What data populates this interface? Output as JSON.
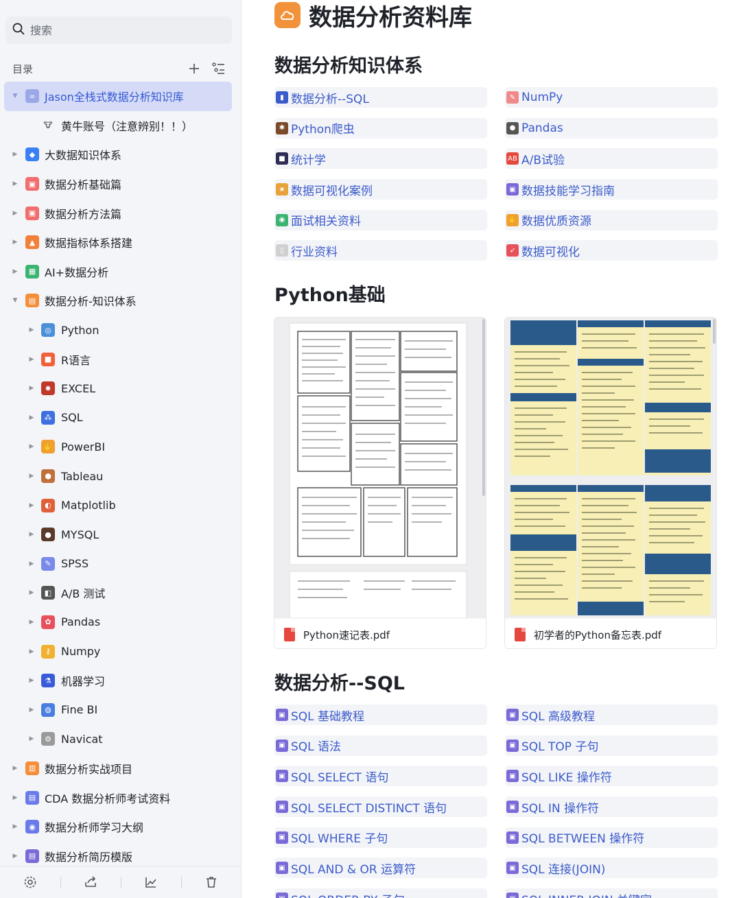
{
  "search": {
    "placeholder": "搜索"
  },
  "toc": {
    "title": "目录",
    "items": [
      {
        "label": "Jason全栈式数据分析知识库",
        "level": 0,
        "expanded": true,
        "selected": true,
        "icon": "link-icon",
        "color": "#9aa8e8",
        "glyph": "∞"
      },
      {
        "label": "黄牛账号（注意辨别！！）",
        "level": 1,
        "expanded": null,
        "selected": false,
        "icon": "cow-icon",
        "color": "#ffffff",
        "glyph": "🐮"
      },
      {
        "label": "大数据知识体系",
        "level": 0,
        "expanded": false,
        "selected": false,
        "icon": "cube-icon",
        "color": "#3a7ff5",
        "glyph": "◆"
      },
      {
        "label": "数据分析基础篇",
        "level": 0,
        "expanded": false,
        "selected": false,
        "icon": "book-icon",
        "color": "#f26d6d",
        "glyph": "▣"
      },
      {
        "label": "数据分析方法篇",
        "level": 0,
        "expanded": false,
        "selected": false,
        "icon": "book-icon",
        "color": "#f26d6d",
        "glyph": "▣"
      },
      {
        "label": "数据指标体系搭建",
        "level": 0,
        "expanded": false,
        "selected": false,
        "icon": "chart-icon",
        "color": "#f0803a",
        "glyph": "▲"
      },
      {
        "label": "AI+数据分析",
        "level": 0,
        "expanded": false,
        "selected": false,
        "icon": "grid-icon",
        "color": "#3cb371",
        "glyph": "▦"
      },
      {
        "label": "数据分析-知识体系",
        "level": 0,
        "expanded": true,
        "selected": false,
        "icon": "folder-icon",
        "color": "#f58e3a",
        "glyph": "▤"
      },
      {
        "label": "Python",
        "level": 1,
        "expanded": false,
        "selected": false,
        "icon": "python-icon",
        "color": "#4a90d9",
        "glyph": "◎"
      },
      {
        "label": "R语言",
        "level": 1,
        "expanded": false,
        "selected": false,
        "icon": "r-icon",
        "color": "#f2623a",
        "glyph": "■"
      },
      {
        "label": "EXCEL",
        "level": 1,
        "expanded": false,
        "selected": false,
        "icon": "bug-icon",
        "color": "#c0392b",
        "glyph": "✸"
      },
      {
        "label": "SQL",
        "level": 1,
        "expanded": false,
        "selected": false,
        "icon": "database-icon",
        "color": "#3d6fe0",
        "glyph": "⁂"
      },
      {
        "label": "PowerBI",
        "level": 1,
        "expanded": false,
        "selected": false,
        "icon": "hand-icon",
        "color": "#f0a030",
        "glyph": "✋"
      },
      {
        "label": "Tableau",
        "level": 1,
        "expanded": false,
        "selected": false,
        "icon": "box-icon",
        "color": "#c0703a",
        "glyph": "⬢"
      },
      {
        "label": "Matplotlib",
        "level": 1,
        "expanded": false,
        "selected": false,
        "icon": "palette-icon",
        "color": "#e0603a",
        "glyph": "◐"
      },
      {
        "label": "MYSQL",
        "level": 1,
        "expanded": false,
        "selected": false,
        "icon": "dolphin-icon",
        "color": "#5b3a2a",
        "glyph": "●"
      },
      {
        "label": "SPSS",
        "level": 1,
        "expanded": false,
        "selected": false,
        "icon": "pen-icon",
        "color": "#7a8ae8",
        "glyph": "✎"
      },
      {
        "label": "A/B 测试",
        "level": 1,
        "expanded": false,
        "selected": false,
        "icon": "cup-icon",
        "color": "#555555",
        "glyph": "◧"
      },
      {
        "label": "Pandas",
        "level": 1,
        "expanded": false,
        "selected": false,
        "icon": "flower-icon",
        "color": "#e8505b",
        "glyph": "✿"
      },
      {
        "label": "Numpy",
        "level": 1,
        "expanded": false,
        "selected": false,
        "icon": "key-icon",
        "color": "#f0b030",
        "glyph": "⚷"
      },
      {
        "label": "机器学习",
        "level": 1,
        "expanded": false,
        "selected": false,
        "icon": "microscope-icon",
        "color": "#3a5bd9",
        "glyph": "⚗"
      },
      {
        "label": "Fine BI",
        "level": 1,
        "expanded": false,
        "selected": false,
        "icon": "globe-icon",
        "color": "#4a7fe0",
        "glyph": "◍"
      },
      {
        "label": "Navicat",
        "level": 1,
        "expanded": false,
        "selected": false,
        "icon": "gear-icon",
        "color": "#9a9a9a",
        "glyph": "⚙"
      },
      {
        "label": "数据分析实战项目",
        "level": 0,
        "expanded": false,
        "selected": false,
        "icon": "briefcase-icon",
        "color": "#f58e3a",
        "glyph": "▥"
      },
      {
        "label": "CDA 数据分析师考试资料",
        "level": 0,
        "expanded": false,
        "selected": false,
        "icon": "doc-icon",
        "color": "#6a7ae8",
        "glyph": "▤"
      },
      {
        "label": "数据分析师学习大纲",
        "level": 0,
        "expanded": false,
        "selected": false,
        "icon": "target-icon",
        "color": "#6a7ae8",
        "glyph": "◉"
      },
      {
        "label": "数据分析简历模版",
        "level": 0,
        "expanded": false,
        "selected": false,
        "icon": "doc-icon",
        "color": "#7a6ad8",
        "glyph": "▤"
      }
    ]
  },
  "doc": {
    "title": "数据分析资料库"
  },
  "sections": [
    {
      "heading": "数据分析知识体系",
      "links": [
        {
          "label": "数据分析--SQL",
          "icon": "bar-chart-icon",
          "color": "#3b5bcb",
          "glyph": "▮"
        },
        {
          "label": "NumPy",
          "icon": "pencil-icon",
          "color": "#f08a8a",
          "glyph": "✎"
        },
        {
          "label": "Python爬虫",
          "icon": "spider-icon",
          "color": "#7a4a2a",
          "glyph": "✱"
        },
        {
          "label": "Pandas",
          "icon": "panda-icon",
          "color": "#555555",
          "glyph": "●"
        },
        {
          "label": "统计学",
          "icon": "save-icon",
          "color": "#2c2c54",
          "glyph": "■"
        },
        {
          "label": "A/B试验",
          "icon": "ab-icon",
          "color": "#e5483f",
          "glyph": "AB"
        },
        {
          "label": "数据可视化案例",
          "icon": "medal-icon",
          "color": "#e8a23a",
          "glyph": "★"
        },
        {
          "label": "数据技能学习指南",
          "icon": "book-icon",
          "color": "#7a6ad8",
          "glyph": "▣"
        },
        {
          "label": "面试相关资料",
          "icon": "chat-icon",
          "color": "#3cb371",
          "glyph": "◉"
        },
        {
          "label": "数据优质资源",
          "icon": "hand-icon",
          "color": "#f0a030",
          "glyph": "✋"
        },
        {
          "label": "行业资料",
          "icon": "bookmark-icon",
          "color": "#d0d0d0",
          "glyph": "▯"
        },
        {
          "label": "数据可视化",
          "icon": "rocket-icon",
          "color": "#e8505b",
          "glyph": "➶"
        }
      ]
    },
    {
      "heading": "Python基础",
      "files": [
        {
          "name": "Python速记表.pdf",
          "icon": "pdf-icon"
        },
        {
          "name": "初学者的Python备忘表.pdf",
          "icon": "pdf-icon"
        }
      ]
    },
    {
      "heading": "数据分析--SQL",
      "links": [
        {
          "label": "SQL 基础教程",
          "icon": "book-icon",
          "color": "#7a6ad8",
          "glyph": "▣"
        },
        {
          "label": "SQL 高级教程",
          "icon": "book-icon",
          "color": "#7a6ad8",
          "glyph": "▣"
        },
        {
          "label": "SQL 语法",
          "icon": "book-icon",
          "color": "#7a6ad8",
          "glyph": "▣"
        },
        {
          "label": "SQL TOP 子句",
          "icon": "book-icon",
          "color": "#7a6ad8",
          "glyph": "▣"
        },
        {
          "label": "SQL SELECT 语句",
          "icon": "book-icon",
          "color": "#7a6ad8",
          "glyph": "▣"
        },
        {
          "label": "SQL LIKE 操作符",
          "icon": "book-icon",
          "color": "#7a6ad8",
          "glyph": "▣"
        },
        {
          "label": "SQL SELECT DISTINCT 语句",
          "icon": "book-icon",
          "color": "#7a6ad8",
          "glyph": "▣"
        },
        {
          "label": "SQL IN 操作符",
          "icon": "book-icon",
          "color": "#7a6ad8",
          "glyph": "▣"
        },
        {
          "label": "SQL WHERE 子句",
          "icon": "book-icon",
          "color": "#7a6ad8",
          "glyph": "▣"
        },
        {
          "label": "SQL BETWEEN 操作符",
          "icon": "book-icon",
          "color": "#7a6ad8",
          "glyph": "▣"
        },
        {
          "label": "SQL AND & OR 运算符",
          "icon": "book-icon",
          "color": "#7a6ad8",
          "glyph": "▣"
        },
        {
          "label": "SQL 连接(JOIN)",
          "icon": "book-icon",
          "color": "#7a6ad8",
          "glyph": "▣"
        },
        {
          "label": "SQL ORDER BY 子句",
          "icon": "book-icon",
          "color": "#7a6ad8",
          "glyph": "▣"
        },
        {
          "label": "SQL INNER JOIN 关键字",
          "icon": "book-icon",
          "color": "#7a6ad8",
          "glyph": "▣"
        }
      ]
    }
  ],
  "colors": {
    "accent": "#3b5bcb",
    "selected_bg": "#d5dbf7",
    "sidebar_bg": "#f4f5f8",
    "link_bg": "#f3f4f7",
    "title_logo": "#f2923a"
  }
}
